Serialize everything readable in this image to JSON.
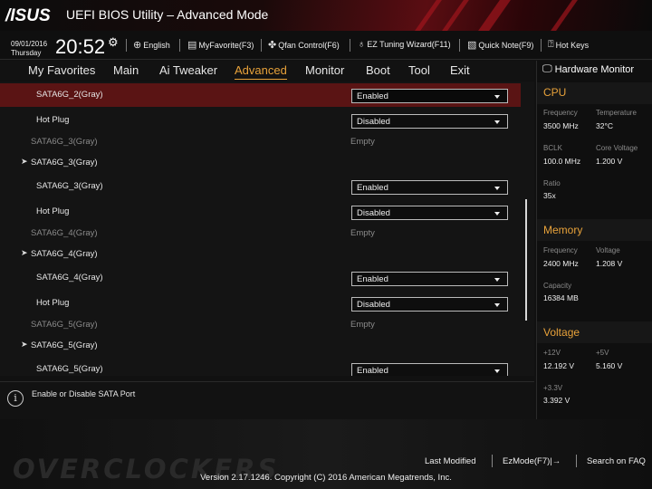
{
  "app": {
    "brand": "/ISUS",
    "title": "UEFI BIOS Utility – Advanced Mode"
  },
  "status": {
    "date": "09/01/2016",
    "day": "Thursday",
    "time": "20:52"
  },
  "toolbar": [
    {
      "label": "English",
      "icon": "globe-icon"
    },
    {
      "label": "MyFavorite(F3)",
      "icon": "favorite-icon"
    },
    {
      "label": "Qfan Control(F6)",
      "icon": "fan-icon"
    },
    {
      "label": "EZ Tuning Wizard(F11)",
      "icon": "bulb-icon"
    },
    {
      "label": "Quick Note(F9)",
      "icon": "note-icon"
    },
    {
      "label": "Hot Keys",
      "icon": "question-icon"
    }
  ],
  "nav": [
    {
      "label": "My Favorites"
    },
    {
      "label": "Main"
    },
    {
      "label": "Ai Tweaker"
    },
    {
      "label": "Advanced",
      "active": true
    },
    {
      "label": "Monitor"
    },
    {
      "label": "Boot"
    },
    {
      "label": "Tool"
    },
    {
      "label": "Exit"
    }
  ],
  "rows": [
    {
      "label": "SATA6G_2(Gray)",
      "control": "Enabled"
    },
    {
      "label": "Hot Plug",
      "control": "Disabled"
    },
    {
      "label": "SATA6G_3(Gray)",
      "value": "Empty"
    },
    {
      "label": "SATA6G_3(Gray)"
    },
    {
      "label": "SATA6G_3(Gray)",
      "control": "Enabled"
    },
    {
      "label": "Hot Plug",
      "control": "Disabled"
    },
    {
      "label": "SATA6G_4(Gray)",
      "value": "Empty"
    },
    {
      "label": "SATA6G_4(Gray)"
    },
    {
      "label": "SATA6G_4(Gray)",
      "control": "Enabled"
    },
    {
      "label": "Hot Plug",
      "control": "Disabled"
    },
    {
      "label": "SATA6G_5(Gray)",
      "value": "Empty"
    },
    {
      "label": "SATA6G_5(Gray)"
    },
    {
      "label": "SATA6G_5(Gray)",
      "control": "Enabled"
    }
  ],
  "help": {
    "text": "Enable or Disable SATA Port"
  },
  "hw": {
    "title": "Hardware Monitor",
    "cpu": {
      "heading": "CPU",
      "frequency_label": "Frequency",
      "frequency": "3500 MHz",
      "temperature_label": "Temperature",
      "temperature": "32°C",
      "bclk_label": "BCLK",
      "bclk": "100.0 MHz",
      "core_voltage_label": "Core Voltage",
      "core_voltage": "1.200 V",
      "ratio_label": "Ratio",
      "ratio": "35x"
    },
    "memory": {
      "heading": "Memory",
      "frequency_label": "Frequency",
      "frequency": "2400 MHz",
      "voltage_label": "Voltage",
      "voltage": "1.208 V",
      "capacity_label": "Capacity",
      "capacity": "16384 MB"
    },
    "voltage": {
      "heading": "Voltage",
      "v12_label": "+12V",
      "v12": "12.192 V",
      "v5_label": "+5V",
      "v5": "5.160 V",
      "v33_label": "+3.3V",
      "v33": "3.392 V"
    }
  },
  "footer": {
    "last_modified": "Last Modified",
    "ezmode": "EzMode(F7)|→",
    "search": "Search on FAQ",
    "copyright": "Version 2.17.1246. Copyright (C) 2016 American Megatrends, Inc.",
    "watermark": "OVERCLOCKERS"
  }
}
